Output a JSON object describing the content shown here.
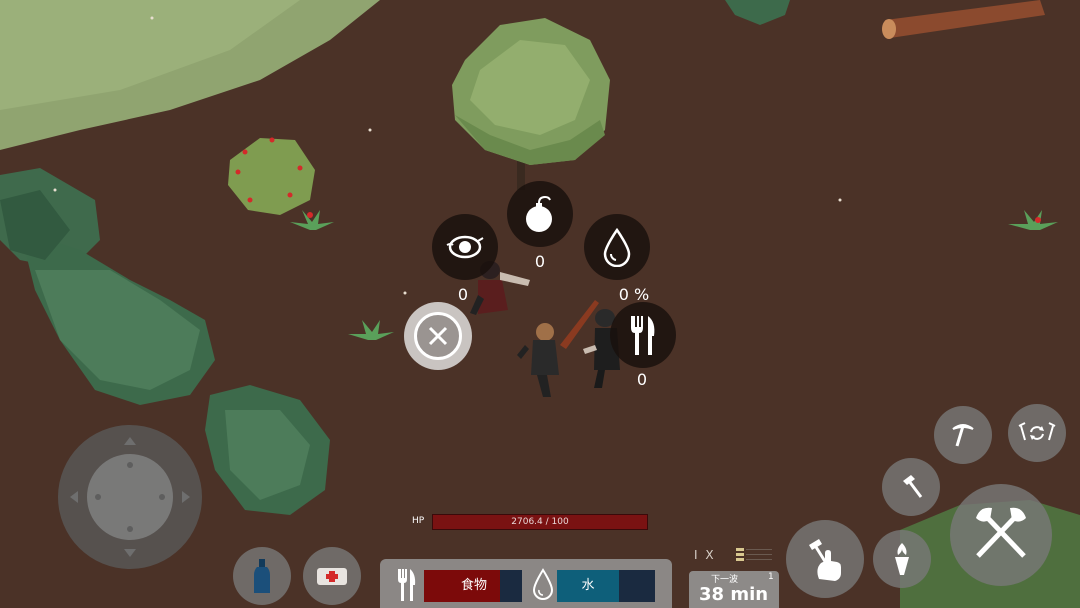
{
  "radial_menu": {
    "items": [
      {
        "name": "eye-tracking",
        "count": "0"
      },
      {
        "name": "bomb",
        "count": "0"
      },
      {
        "name": "water-drop",
        "count": "0 %"
      },
      {
        "name": "food",
        "count": "0"
      }
    ]
  },
  "hp": {
    "label": "HP",
    "text": "2706.4 / 100"
  },
  "status": {
    "food_label": "食物",
    "water_label": "水"
  },
  "wave": {
    "label": "下一波",
    "number": "1",
    "time": "38 min"
  },
  "speed": {
    "text": "I X"
  },
  "colors": {
    "ground": "#4b3227",
    "grass": "#8fa36e",
    "hp_bar": "#7a1212",
    "food_bar": "#7c0a0a",
    "water_bar": "#0e5f7a"
  }
}
